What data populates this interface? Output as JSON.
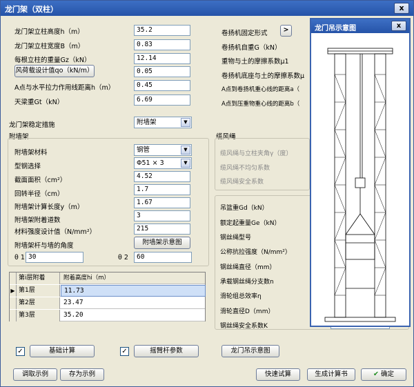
{
  "window": {
    "title": "龙门架（双柱）",
    "close": "x"
  },
  "fields": [
    {
      "label": "龙门架立柱高度h（m）",
      "value": "35.2"
    },
    {
      "label": "龙门架立柱宽度B（m）",
      "value": "0.83"
    },
    {
      "label": "每根立柱的重量Gz（kN）",
      "value": "12.14"
    },
    {
      "label": "风荷载设计值qo（kN/m）",
      "value": "0.05"
    },
    {
      "label": "A点与水平拉力作用线距离h（m）",
      "value": "0.45"
    },
    {
      "label": "天梁重Gt（kN）",
      "value": "6.69"
    }
  ],
  "right_labels": [
    "卷扬机固定形式",
    "卷扬机自重G（kN）",
    "重物与土的摩擦系数μ1",
    "卷扬机底座与土的摩擦系数μ",
    "A点到卷扬机重心线的距离a（",
    "A点到压重物重心线的距离b（"
  ],
  "fix_button": ">",
  "stability": {
    "label": "龙门架稳定措施",
    "value": "附墙架"
  },
  "wall": {
    "title": "附墙架",
    "material_label": "附墙架材料",
    "material_value": "钢管",
    "steel_label": "型钢选择",
    "steel_value": "Φ51 × 3",
    "rows": [
      {
        "label": "截面面积（cm²）",
        "value": "4.52"
      },
      {
        "label": "回转半径（cm）",
        "value": "1.7"
      },
      {
        "label": "附墙架计算长度y（m）",
        "value": "1.67"
      },
      {
        "label": "附墙架附着道数",
        "value": "3"
      },
      {
        "label": "材料强度设计值（N/mm²）",
        "value": "215"
      }
    ],
    "angle_label": "附墙架杆与墙的角度",
    "diagram_button": "附墙架示意图",
    "theta1_label": "θ 1",
    "theta1_value": "30",
    "theta2_label": "θ 2",
    "theta2_value": "60"
  },
  "table": {
    "headers": [
      "第i层附着",
      "附着高度hi（m）"
    ],
    "rows": [
      {
        "layer": "第1层",
        "height": "11.73"
      },
      {
        "layer": "第2层",
        "height": "23.47"
      },
      {
        "layer": "第3层",
        "height": "35.20"
      }
    ]
  },
  "rope": {
    "title": "缆风绳",
    "labels": [
      "缆风绳与立柱夹角γ（度）",
      "缆风绳不均匀系数",
      "缆风绳安全系数"
    ]
  },
  "hoist": {
    "labels": [
      "吊篮重Gd（kN）",
      "额定起重量Ge（kN）",
      "钢丝绳型号",
      "公称抗拉强度（N/mm²）",
      "钢丝绳直径（mm）",
      "承载钢丝绳分支数n",
      "滑轮组总效率η",
      "滑轮直径D（mm）",
      "钢丝绳安全系数K"
    ],
    "k_value": "7.97"
  },
  "bottom": {
    "foundation_button": "基础计算",
    "arm_button": "摇臂杆参数",
    "gantry_diagram_button": "龙门吊示意图",
    "load_button": "调取示例",
    "save_button": "存为示例",
    "quick_button": "快速试算",
    "book_button": "生成计算书",
    "ok_button": "确定"
  },
  "popup": {
    "title": "龙门吊示意图",
    "close": "x"
  }
}
